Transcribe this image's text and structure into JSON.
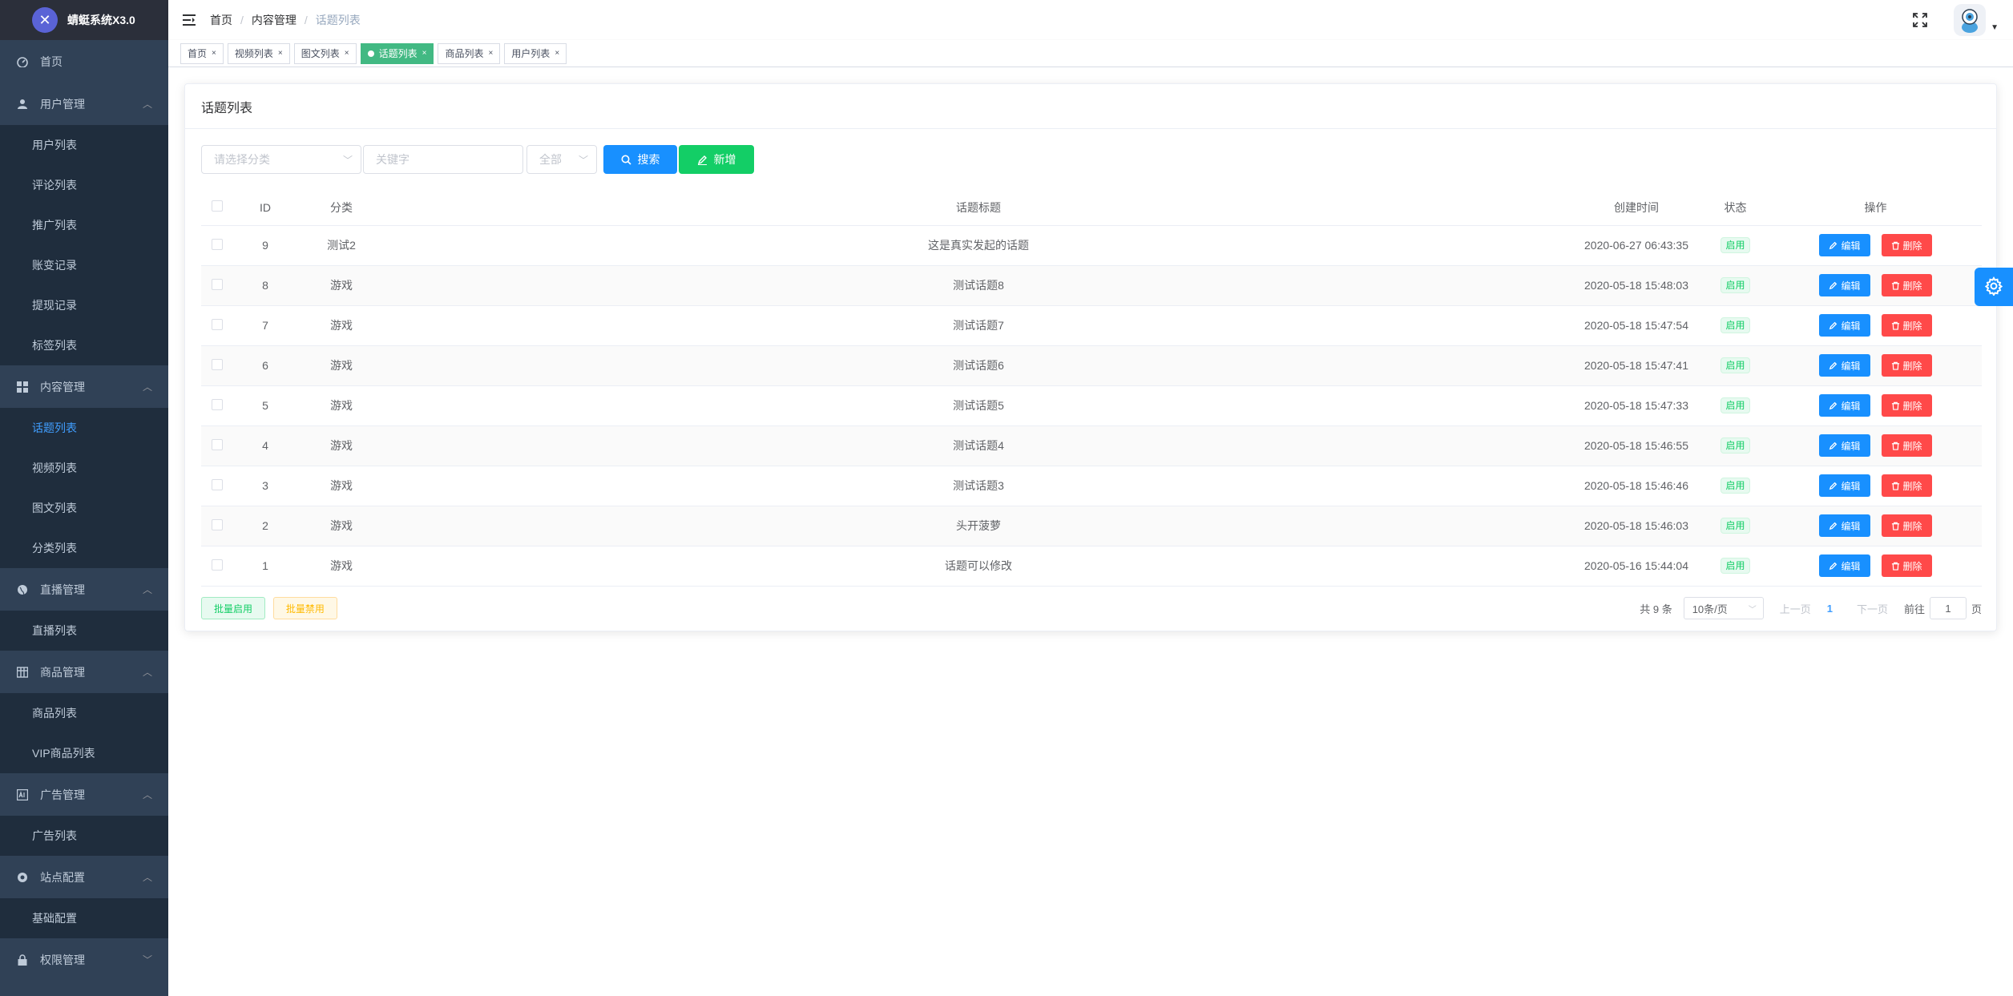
{
  "app": {
    "title": "蜻蜓系统X3.0"
  },
  "sidebar": {
    "items": [
      {
        "label": "首页",
        "icon": "dashboard-icon"
      },
      {
        "label": "用户管理",
        "icon": "user-icon",
        "children": [
          "用户列表",
          "评论列表",
          "推广列表",
          "账变记录",
          "提现记录",
          "标签列表"
        ]
      },
      {
        "label": "内容管理",
        "icon": "grid-icon",
        "children": [
          "话题列表",
          "视频列表",
          "图文列表",
          "分类列表"
        ]
      },
      {
        "label": "直播管理",
        "icon": "globe-icon",
        "children": [
          "直播列表"
        ]
      },
      {
        "label": "商品管理",
        "icon": "table-icon",
        "children": [
          "商品列表",
          "VIP商品列表"
        ]
      },
      {
        "label": "广告管理",
        "icon": "ad-icon",
        "children": [
          "广告列表"
        ]
      },
      {
        "label": "站点配置",
        "icon": "lifebuoy-icon",
        "children": [
          "基础配置"
        ]
      },
      {
        "label": "权限管理",
        "icon": "lock-icon"
      }
    ],
    "active_child": "话题列表"
  },
  "breadcrumb": [
    "首页",
    "内容管理",
    "话题列表"
  ],
  "tags": [
    {
      "label": "首页",
      "active": false
    },
    {
      "label": "视频列表",
      "active": false
    },
    {
      "label": "图文列表",
      "active": false
    },
    {
      "label": "话题列表",
      "active": true
    },
    {
      "label": "商品列表",
      "active": false
    },
    {
      "label": "用户列表",
      "active": false
    }
  ],
  "card": {
    "title": "话题列表"
  },
  "filters": {
    "category_placeholder": "请选择分类",
    "keyword_placeholder": "关键字",
    "status_value": "全部",
    "search_label": "搜索",
    "add_label": "新增"
  },
  "table": {
    "headers": [
      "ID",
      "分类",
      "话题标题",
      "创建时间",
      "状态",
      "操作"
    ],
    "edit_label": "编辑",
    "delete_label": "删除",
    "rows": [
      {
        "id": "9",
        "category": "测试2",
        "title": "这是真实发起的话题",
        "created": "2020-06-27 06:43:35",
        "status": "启用"
      },
      {
        "id": "8",
        "category": "游戏",
        "title": "测试话题8",
        "created": "2020-05-18 15:48:03",
        "status": "启用"
      },
      {
        "id": "7",
        "category": "游戏",
        "title": "测试话题7",
        "created": "2020-05-18 15:47:54",
        "status": "启用"
      },
      {
        "id": "6",
        "category": "游戏",
        "title": "测试话题6",
        "created": "2020-05-18 15:47:41",
        "status": "启用"
      },
      {
        "id": "5",
        "category": "游戏",
        "title": "测试话题5",
        "created": "2020-05-18 15:47:33",
        "status": "启用"
      },
      {
        "id": "4",
        "category": "游戏",
        "title": "测试话题4",
        "created": "2020-05-18 15:46:55",
        "status": "启用"
      },
      {
        "id": "3",
        "category": "游戏",
        "title": "测试话题3",
        "created": "2020-05-18 15:46:46",
        "status": "启用"
      },
      {
        "id": "2",
        "category": "游戏",
        "title": "头开菠萝",
        "created": "2020-05-18 15:46:03",
        "status": "启用"
      },
      {
        "id": "1",
        "category": "游戏",
        "title": "话题可以修改",
        "created": "2020-05-16 15:44:04",
        "status": "启用"
      }
    ]
  },
  "batch": {
    "enable_label": "批量启用",
    "disable_label": "批量禁用"
  },
  "pagination": {
    "total": "共 9 条",
    "page_size": "10条/页",
    "prev": "上一页",
    "current": "1",
    "next": "下一页",
    "goto_prefix": "前往",
    "goto_value": "1",
    "goto_suffix": "页"
  },
  "colors": {
    "sidebar_bg": "#304156",
    "primary": "#1890ff",
    "success": "#13ce66",
    "danger": "#ff4949",
    "tag_active": "#42b983"
  }
}
